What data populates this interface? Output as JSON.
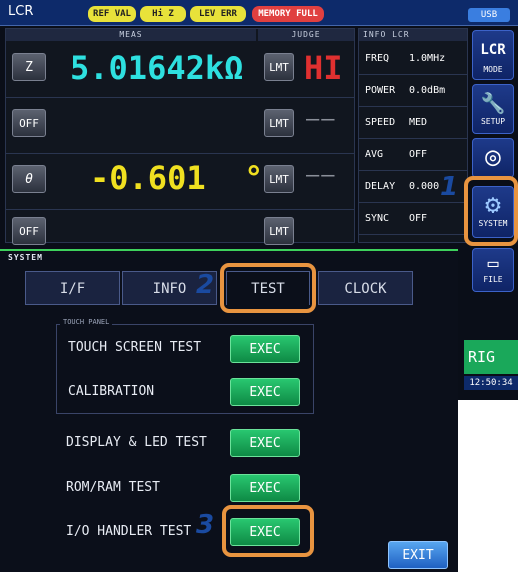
{
  "meter": {
    "title": "LCR",
    "flags": [
      "REF VAL",
      "Hi Z",
      "LEV ERR",
      "MEMORY FULL"
    ],
    "usb": "USB",
    "meas_header": "MEAS",
    "judge_header": "JUDGE",
    "rows": [
      {
        "param": "Z",
        "value": "5.01642kΩ",
        "judge_btn": "LMT",
        "judge": "HI"
      },
      {
        "param": "OFF",
        "value": "",
        "judge_btn": "LMT",
        "judge": "——"
      },
      {
        "param": "θ",
        "value": "-0.601  °",
        "judge_btn": "LMT",
        "judge": "——"
      },
      {
        "param": "OFF",
        "value": "",
        "judge_btn": "LMT",
        "judge": ""
      }
    ],
    "info_header": "INFO LCR",
    "info": [
      {
        "key": "FREQ",
        "val": "1.0MHz"
      },
      {
        "key": "POWER",
        "val": "0.0dBm"
      },
      {
        "key": "SPEED",
        "val": "MED"
      },
      {
        "key": "AVG",
        "val": "OFF"
      },
      {
        "key": "DELAY",
        "val": "0.000"
      },
      {
        "key": "SYNC",
        "val": "OFF"
      }
    ],
    "side": [
      {
        "icon": "LCR",
        "label": "MODE"
      },
      {
        "icon": "🔧",
        "label": "SETUP"
      },
      {
        "icon": "◎",
        "label": ""
      },
      {
        "icon": "⚙",
        "label": "SYSTEM"
      },
      {
        "icon": "▭",
        "label": "FILE"
      }
    ],
    "trig": "RIG",
    "clock": "12:50:34"
  },
  "dialog": {
    "title": "SYSTEM",
    "tabs": [
      "I/F",
      "INFO",
      "TEST",
      "CLOCK"
    ],
    "active_tab": "TEST",
    "group_label": "TOUCH PANEL",
    "items": [
      {
        "label": "TOUCH SCREEN TEST",
        "button": "EXEC"
      },
      {
        "label": "CALIBRATION",
        "button": "EXEC"
      },
      {
        "label": "DISPLAY & LED TEST",
        "button": "EXEC"
      },
      {
        "label": "ROM/RAM TEST",
        "button": "EXEC"
      },
      {
        "label": "I/O HANDLER TEST",
        "button": "EXEC"
      }
    ],
    "exit": "EXIT"
  },
  "callouts": [
    "1",
    "2",
    "3"
  ],
  "colors": {
    "accent_orange": "#e89440",
    "exec_green": "#1aa85a",
    "hi_red": "#e03030",
    "value_cyan": "#2ee0e0",
    "value_yellow": "#f0e020"
  }
}
